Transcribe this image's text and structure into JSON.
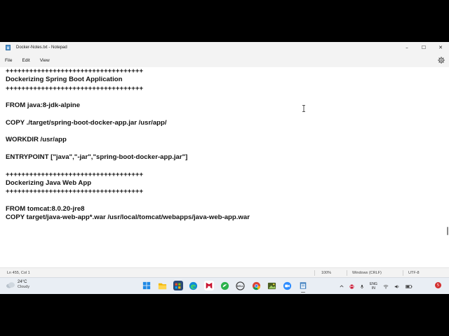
{
  "window": {
    "title": "Docker-Notes.txt - Notepad",
    "controls": {
      "minimize": "–",
      "maximize": "☐",
      "close": "✕"
    }
  },
  "menu": {
    "file": "File",
    "edit": "Edit",
    "view": "View"
  },
  "editor": {
    "lines": [
      "+++++++++++++++++++++++++++++++++++",
      "Dockerizing Spring Boot Application",
      "+++++++++++++++++++++++++++++++++++",
      "",
      "FROM java:8-jdk-alpine",
      "",
      "COPY ./target/spring-boot-docker-app.jar /usr/app/",
      "",
      "WORKDIR /usr/app",
      "",
      "ENTRYPOINT [\"java\",\"-jar\",\"spring-boot-docker-app.jar\"]",
      "",
      "+++++++++++++++++++++++++++++++++++",
      "Dockerizing Java Web App",
      "+++++++++++++++++++++++++++++++++++",
      "",
      "FROM tomcat:8.0.20-jre8",
      "COPY target/java-web-app*.war /usr/local/tomcat/webapps/java-web-app.war"
    ]
  },
  "status": {
    "position": "Ln 455, Col 1",
    "zoom": "100%",
    "line_ending": "Windows (CRLF)",
    "encoding": "UTF-8"
  },
  "taskbar": {
    "weather": {
      "temp": "24°C",
      "condition": "Cloudy"
    },
    "icons": [
      {
        "name": "start-icon",
        "color": "#1e88e5"
      },
      {
        "name": "file-explorer-icon",
        "color": "#f2b705"
      },
      {
        "name": "store-icon",
        "color": "#2b4a78"
      },
      {
        "name": "edge-icon",
        "color": "#0f8ad8"
      },
      {
        "name": "mcafee-icon",
        "color": "#c8102e"
      },
      {
        "name": "feedly-icon",
        "color": "#2bb24c"
      },
      {
        "name": "dell-icon",
        "color": "#3a3a3a"
      },
      {
        "name": "chrome-icon",
        "color": "#db4437"
      },
      {
        "name": "photos-icon",
        "color": "#4a5d23"
      },
      {
        "name": "zoom-icon",
        "color": "#2d8cff"
      },
      {
        "name": "notepad-icon",
        "color": "#3f7fbf"
      }
    ],
    "tray": {
      "lang_top": "ENG",
      "lang_bottom": "IN",
      "notifications": "5"
    }
  }
}
